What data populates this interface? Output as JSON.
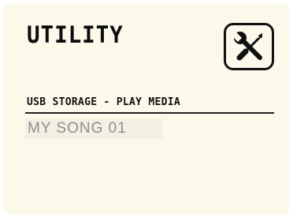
{
  "screen": {
    "title": "UTILITY",
    "header_icon": "tools-icon",
    "section_label": "USB STORAGE - PLAY MEDIA",
    "media_items": [
      {
        "label": "MY SONG 01"
      }
    ]
  }
}
